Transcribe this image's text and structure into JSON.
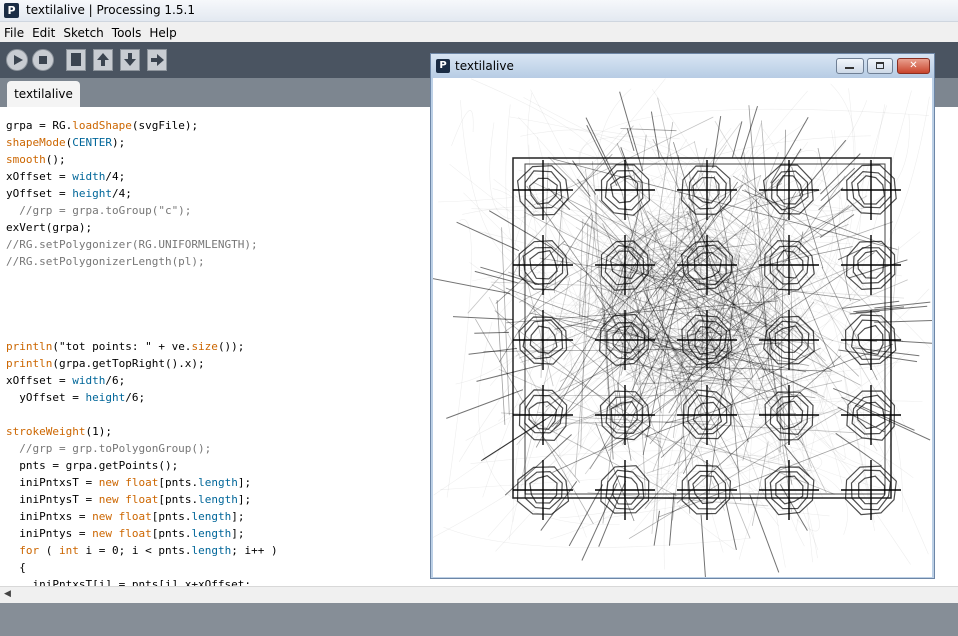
{
  "window": {
    "title": "textilalive | Processing 1.5.1",
    "app_icon": "P"
  },
  "menu": [
    "File",
    "Edit",
    "Sketch",
    "Tools",
    "Help"
  ],
  "toolbar": {
    "buttons": [
      "run-icon",
      "stop-icon",
      "new-icon",
      "open-icon",
      "save-icon",
      "export-icon"
    ]
  },
  "tabs": [
    {
      "label": "textilalive"
    }
  ],
  "editor": {
    "lines": [
      [
        {
          "t": "grpa = RG.",
          "c": ""
        },
        {
          "t": "loadShape",
          "c": "kw"
        },
        {
          "t": "(svgFile);",
          "c": ""
        }
      ],
      [
        {
          "t": "shapeMode",
          "c": "kw"
        },
        {
          "t": "(",
          "c": ""
        },
        {
          "t": "CENTER",
          "c": "fn"
        },
        {
          "t": ");",
          "c": ""
        }
      ],
      [
        {
          "t": "smooth",
          "c": "kw"
        },
        {
          "t": "();",
          "c": ""
        }
      ],
      [
        {
          "t": "xOffset = ",
          "c": ""
        },
        {
          "t": "width",
          "c": "fn"
        },
        {
          "t": "/4;",
          "c": ""
        }
      ],
      [
        {
          "t": "yOffset = ",
          "c": ""
        },
        {
          "t": "height",
          "c": "fn"
        },
        {
          "t": "/4;",
          "c": ""
        }
      ],
      [
        {
          "t": "  //grp = grpa.toGroup(\"c\");",
          "c": "cm"
        }
      ],
      [
        {
          "t": "exVert(grpa);",
          "c": ""
        }
      ],
      [
        {
          "t": "//RG.setPolygonizer(RG.UNIFORMLENGTH);",
          "c": "cm"
        }
      ],
      [
        {
          "t": "//RG.setPolygonizerLength(pl);",
          "c": "cm"
        }
      ],
      [],
      [],
      [],
      [],
      [
        {
          "t": "println",
          "c": "kw"
        },
        {
          "t": "(\"tot points: \" + ve.",
          "c": ""
        },
        {
          "t": "size",
          "c": "kw"
        },
        {
          "t": "());",
          "c": ""
        }
      ],
      [
        {
          "t": "println",
          "c": "kw"
        },
        {
          "t": "(grpa.getTopRight().x);",
          "c": ""
        }
      ],
      [
        {
          "t": "xOffset = ",
          "c": ""
        },
        {
          "t": "width",
          "c": "fn"
        },
        {
          "t": "/6;",
          "c": ""
        }
      ],
      [
        {
          "t": "  yOffset = ",
          "c": ""
        },
        {
          "t": "height",
          "c": "fn"
        },
        {
          "t": "/6;",
          "c": ""
        }
      ],
      [],
      [
        {
          "t": "strokeWeight",
          "c": "kw"
        },
        {
          "t": "(1);",
          "c": ""
        }
      ],
      [
        {
          "t": "  //grp = grp.toPolygonGroup();",
          "c": "cm"
        }
      ],
      [
        {
          "t": "  pnts = grpa.getPoints();",
          "c": ""
        }
      ],
      [
        {
          "t": "  iniPntxsT = ",
          "c": ""
        },
        {
          "t": "new",
          "c": "kw"
        },
        {
          "t": " ",
          "c": ""
        },
        {
          "t": "float",
          "c": "kw"
        },
        {
          "t": "[pnts.",
          "c": ""
        },
        {
          "t": "length",
          "c": "fn"
        },
        {
          "t": "];",
          "c": ""
        }
      ],
      [
        {
          "t": "  iniPntysT = ",
          "c": ""
        },
        {
          "t": "new",
          "c": "kw"
        },
        {
          "t": " ",
          "c": ""
        },
        {
          "t": "float",
          "c": "kw"
        },
        {
          "t": "[pnts.",
          "c": ""
        },
        {
          "t": "length",
          "c": "fn"
        },
        {
          "t": "];",
          "c": ""
        }
      ],
      [
        {
          "t": "  iniPntxs = ",
          "c": ""
        },
        {
          "t": "new",
          "c": "kw"
        },
        {
          "t": " ",
          "c": ""
        },
        {
          "t": "float",
          "c": "kw"
        },
        {
          "t": "[pnts.",
          "c": ""
        },
        {
          "t": "length",
          "c": "fn"
        },
        {
          "t": "];",
          "c": ""
        }
      ],
      [
        {
          "t": "  iniPntys = ",
          "c": ""
        },
        {
          "t": "new",
          "c": "kw"
        },
        {
          "t": " ",
          "c": ""
        },
        {
          "t": "float",
          "c": "kw"
        },
        {
          "t": "[pnts.",
          "c": ""
        },
        {
          "t": "length",
          "c": "fn"
        },
        {
          "t": "];",
          "c": ""
        }
      ],
      [
        {
          "t": "  ",
          "c": ""
        },
        {
          "t": "for",
          "c": "kw"
        },
        {
          "t": " ( ",
          "c": ""
        },
        {
          "t": "int",
          "c": "kw"
        },
        {
          "t": " i = 0; i < pnts.",
          "c": ""
        },
        {
          "t": "length",
          "c": "fn"
        },
        {
          "t": "; i++ )",
          "c": ""
        }
      ],
      [
        {
          "t": "  {",
          "c": ""
        }
      ],
      [
        {
          "t": "    iniPntxsT[i] = pnts[i].x+xOffset;",
          "c": ""
        }
      ]
    ]
  },
  "sketch_window": {
    "title": "textilalive",
    "icon": "P",
    "buttons": [
      "minimize-icon",
      "maximize-icon",
      "close-icon"
    ]
  },
  "colors": {
    "toolbar": "#4a5461",
    "tabbar": "#7d8690",
    "keyword": "#cc6600",
    "constant": "#006699",
    "comment": "#777777"
  }
}
